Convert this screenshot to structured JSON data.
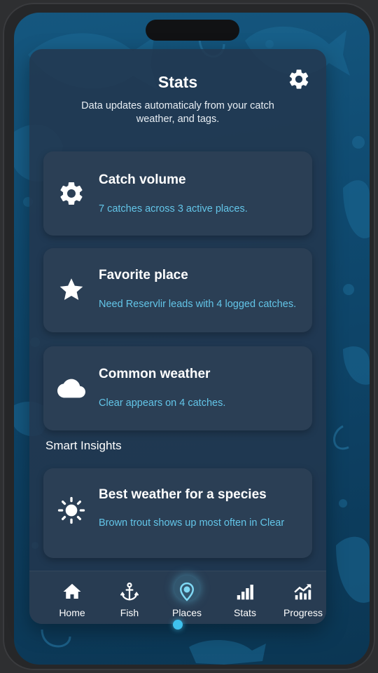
{
  "header": {
    "title": "Stats",
    "subtitle": "Data updates automaticaly from your catch weather, and tags.",
    "settings_icon": "gear-icon"
  },
  "cards": [
    {
      "icon": "gear-icon",
      "title": "Catch volume",
      "description": "7 catches across 3 active places."
    },
    {
      "icon": "star-icon",
      "title": "Favorite place",
      "description": "Need Reservlir leads with 4 logged catches."
    },
    {
      "icon": "cloud-icon",
      "title": "Common weather",
      "description": "Clear appears on 4 catches."
    }
  ],
  "insights": {
    "label": "Smart Insights",
    "cards": [
      {
        "icon": "sun-icon",
        "title": "Best weather for a species",
        "description": "Brown trout shows up most often in Clear"
      }
    ]
  },
  "tabs": [
    {
      "icon": "home-icon",
      "label": "Home"
    },
    {
      "icon": "anchor-icon",
      "label": "Fish"
    },
    {
      "icon": "location-pin-icon",
      "label": "Places",
      "active": true
    },
    {
      "icon": "bar-chart-icon",
      "label": "Stats"
    },
    {
      "icon": "trending-up-icon",
      "label": "Progress"
    }
  ],
  "colors": {
    "background": "#0f4a70",
    "card": "#2b3f55",
    "accent": "#63c5e8",
    "active_dot": "#3fc2ee"
  }
}
